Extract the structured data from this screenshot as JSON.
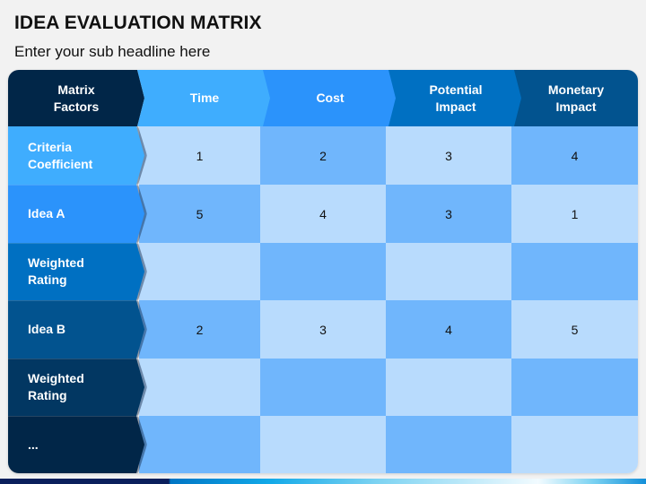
{
  "title": "IDEA EVALUATION MATRIX",
  "subtitle": "Enter your sub headline here",
  "matrix": {
    "corner_label": "Matrix\nFactors",
    "columns": [
      {
        "label": "Time",
        "color": "#3fadfe"
      },
      {
        "label": "Cost",
        "color": "#2b93fb"
      },
      {
        "label": "Potential Impact",
        "color": "#0070c2"
      },
      {
        "label": "Monetary Impact",
        "color": "#02538f"
      }
    ],
    "corner_color": "#012648",
    "rows": [
      {
        "label": "Criteria Coefficient",
        "color": "#3fadfe",
        "values": [
          "1",
          "2",
          "3",
          "4"
        ]
      },
      {
        "label": "Idea A",
        "color": "#2b93fb",
        "values": [
          "5",
          "4",
          "3",
          "1"
        ]
      },
      {
        "label": "Weighted Rating",
        "color": "#0070c2",
        "values": [
          "",
          "",
          "",
          ""
        ]
      },
      {
        "label": "Idea B",
        "color": "#02538f",
        "values": [
          "2",
          "3",
          "4",
          "5"
        ]
      },
      {
        "label": "Weighted Rating",
        "color": "#023762",
        "values": [
          "",
          "",
          "",
          ""
        ]
      },
      {
        "label": "...",
        "color": "#012648",
        "values": [
          "",
          "",
          "",
          ""
        ]
      }
    ],
    "cell_colors": {
      "light": "#b8dbfd",
      "medium": "#70b6fc"
    }
  }
}
